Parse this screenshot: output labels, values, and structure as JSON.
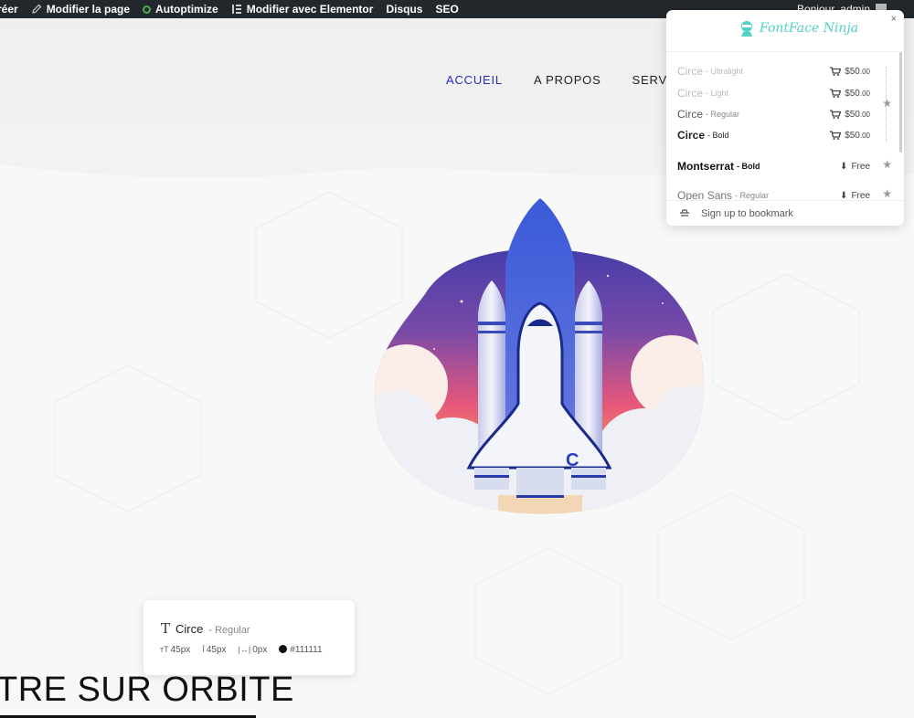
{
  "adminbar": {
    "items": [
      {
        "label": "réer"
      },
      {
        "label": "Modifier la page",
        "icon": "pencil-icon"
      },
      {
        "label": "Autoptimize",
        "icon": "status-ring-icon"
      },
      {
        "label": "Modifier avec Elementor",
        "icon": "elementor-icon"
      },
      {
        "label": "Disqus"
      },
      {
        "label": "SEO"
      }
    ],
    "greeting": "Bonjour, admin"
  },
  "nav": {
    "items": [
      {
        "label": "ACCUEIL",
        "active": true
      },
      {
        "label": "A PROPOS",
        "active": false
      },
      {
        "label": "SERVICES",
        "active": false
      }
    ],
    "active_color": "#2b2bbf"
  },
  "headline": "TRE SUR ORBITE",
  "tooltip": {
    "family": "Circe",
    "weight": "- Regular",
    "font_size": "45px",
    "line_height": "45px",
    "letter_spacing": "0px",
    "color": "#111111"
  },
  "ffn": {
    "logo": "FontFace Ninja",
    "close": "×",
    "fonts": [
      {
        "family": "Circe",
        "weight": "- Ultralight",
        "price": "$50",
        "cents": ".00",
        "kind": "buy",
        "color": "#bbbbbb"
      },
      {
        "family": "Circe",
        "weight": "- Light",
        "price": "$50",
        "cents": ".00",
        "kind": "buy",
        "color": "#bbbbbb"
      },
      {
        "family": "Circe",
        "weight": "- Regular",
        "price": "$50",
        "cents": ".00",
        "kind": "buy",
        "color": "#555555"
      },
      {
        "family": "Circe",
        "weight": "- Bold",
        "price": "$50",
        "cents": ".00",
        "kind": "buy",
        "color": "#222222"
      },
      {
        "family": "Montserrat",
        "weight": "- Bold",
        "price": "Free",
        "cents": "",
        "kind": "free",
        "color": "#111111"
      },
      {
        "family": "Open Sans",
        "weight": "- Regular",
        "price": "Free",
        "cents": "",
        "kind": "free",
        "color": "#777777"
      }
    ],
    "footer": "Sign up to bookmark",
    "accent": "#4fd1c5"
  }
}
